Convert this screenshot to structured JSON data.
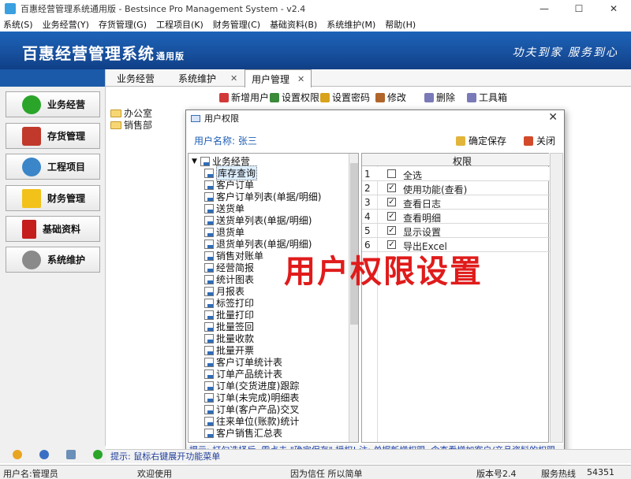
{
  "window": {
    "title": "百惠经营管理系统通用版 - Bestsince Pro Management System - v2.4",
    "controls": [
      "—",
      "☐",
      "✕"
    ]
  },
  "menu": [
    "系统(S)",
    "业务经营(Y)",
    "存货管理(G)",
    "工程项目(K)",
    "财务管理(C)",
    "基础资料(B)",
    "系统维护(M)",
    "帮助(H)"
  ],
  "banner": {
    "brand": "百惠经营管理系统",
    "edition": "通用版",
    "slogan": "功夫到家  服务到心"
  },
  "sidebar": [
    {
      "label": "业务经营",
      "icon": "check-circle-icon",
      "color": "#2aa52a"
    },
    {
      "label": "存货管理",
      "icon": "house-icon",
      "color": "#c0392b"
    },
    {
      "label": "工程项目",
      "icon": "cycle-arrows-icon",
      "color": "#3a86c8"
    },
    {
      "label": "财务管理",
      "icon": "star-icon",
      "color": "#f2c21a"
    },
    {
      "label": "基础资料",
      "icon": "book-icon",
      "color": "#c51c1c"
    },
    {
      "label": "系统维护",
      "icon": "gear-icon",
      "color": "#8a8a8a"
    }
  ],
  "tabs": [
    {
      "label": "业务经营"
    },
    {
      "label": "系统维护"
    },
    {
      "label": "用户管理",
      "active": true
    }
  ],
  "toolbar": [
    {
      "label": "新增用户",
      "icon": "add-user-icon",
      "color": "#d23a3a"
    },
    {
      "label": "设置权限",
      "icon": "settings-icon",
      "color": "#3a8a3a"
    },
    {
      "label": "设置密码",
      "icon": "lock-icon",
      "color": "#d9a21b"
    },
    {
      "label": "修改",
      "icon": "tools-icon",
      "color": "#b0652a"
    },
    {
      "label": "删除",
      "icon": "trash-icon",
      "color": "#7a7ab8"
    },
    {
      "label": "工具箱",
      "icon": "toolbox-icon",
      "color": "#7a7ab8"
    }
  ],
  "dept_tree": [
    "办公室",
    "销售部"
  ],
  "dialog": {
    "title": "用户权限",
    "user_label": "用户名称: 张三",
    "save_label": "确定保存",
    "close_label": "关闭",
    "tree_root": "业务经营",
    "tree_items": [
      "库存查询",
      "客户订单",
      "客户订单列表(单据/明细)",
      "送货单",
      "送货单列表(单据/明细)",
      "退货单",
      "退货单列表(单据/明细)",
      "销售对账单",
      "经营简报",
      "统计图表",
      "月报表",
      "标签打印",
      "批量打印",
      "批量签回",
      "批量收款",
      "批量开票",
      "客户订单统计表",
      "订单产品统计表",
      "订单(交货进度)跟踪",
      "订单(未完成)明细表",
      "订单(客户产品)交叉",
      "往来单位(账款)统计",
      "客户销售汇总表"
    ],
    "grid_header": "权限",
    "grid_rows": [
      {
        "num": "1",
        "label": "全选",
        "checked": false
      },
      {
        "num": "2",
        "label": "使用功能(查看)",
        "checked": true
      },
      {
        "num": "3",
        "label": "查看日志",
        "checked": true
      },
      {
        "num": "4",
        "label": "查看明细",
        "checked": true
      },
      {
        "num": "5",
        "label": "显示设置",
        "checked": true
      },
      {
        "num": "6",
        "label": "导出Excel",
        "checked": true
      }
    ],
    "footer": "提示: 打勾选择后, 需点击 \"确定保存\" 授权! 注: 单据新增权限, 含查看增加客户/产品资料的权限。"
  },
  "overlay_text": "用户权限设置",
  "hint": "提示: 鼠标右键展开功能菜单",
  "status": {
    "user": "用户名:管理员",
    "welcome": "欢迎使用",
    "motto": "因为信任 所以简单",
    "version": "版本号2.4",
    "service": "服务热线",
    "number": "54351"
  }
}
